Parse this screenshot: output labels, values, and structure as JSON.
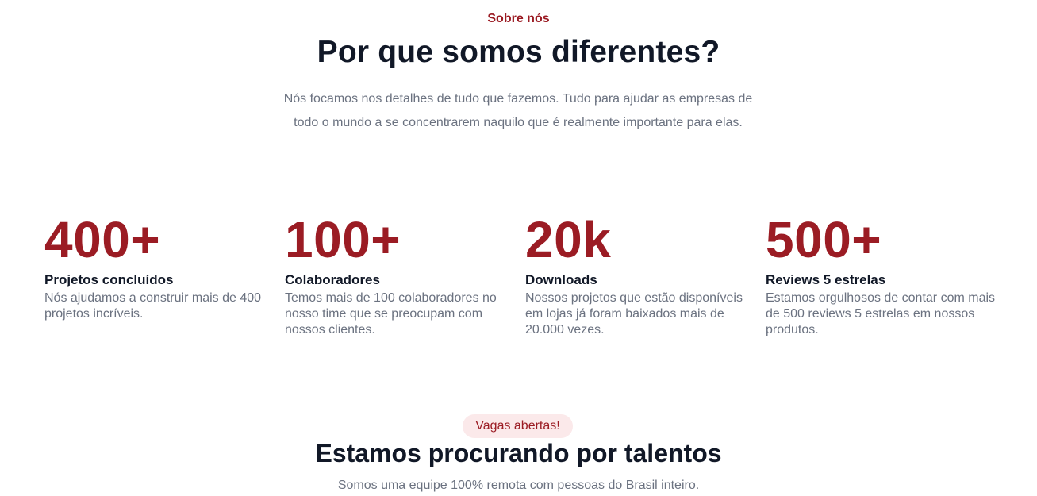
{
  "about": {
    "eyebrow": "Sobre nós",
    "title": "Por que somos diferentes?",
    "intro_line1": "Nós focamos nos detalhes de tudo que fazemos. Tudo para ajudar as empresas de",
    "intro_line2": "todo o mundo a se concentrarem naquilo que é realmente importante para elas."
  },
  "stats": [
    {
      "value": "400+",
      "label": "Projetos concluídos",
      "desc": "Nós ajudamos a construir mais de 400 projetos incríveis."
    },
    {
      "value": "100+",
      "label": "Colaboradores",
      "desc": "Temos mais de 100 colaboradores no nosso time que se preocupam com nossos clientes."
    },
    {
      "value": "20k",
      "label": "Downloads",
      "desc": "Nossos projetos que estão disponíveis em lojas já foram baixados mais de 20.000 vezes."
    },
    {
      "value": "500+",
      "label": "Reviews 5 estrelas",
      "desc": "Estamos orgulhosos de contar com mais de 500 reviews 5 estrelas em nossos produtos."
    }
  ],
  "jobs": {
    "badge": "Vagas abertas!",
    "title": "Estamos procurando por talentos",
    "subtitle": "Somos uma equipe 100% remota com pessoas do Brasil inteiro."
  },
  "colors": {
    "accent": "#9b1c24",
    "heading": "#111827",
    "muted": "#6b7280",
    "badge_bg": "#fbe9ea"
  }
}
